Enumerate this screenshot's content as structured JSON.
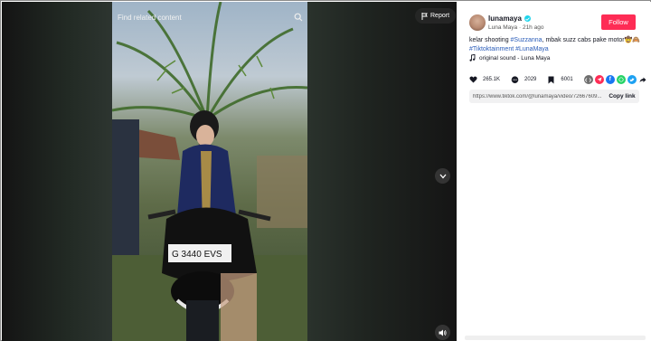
{
  "overlay": {
    "find_related": "Find related content",
    "report_label": "Report"
  },
  "author": {
    "username": "lunamaya",
    "display_name": "Luna Maya",
    "posted": "21h ago",
    "follow_label": "Follow"
  },
  "caption": {
    "text": "kelar shooting ",
    "tag1": "#Suzzanna",
    "text2": ", mbak suzz cabs pake motor🤠🙈 ",
    "tag2": "#Tiktoktainment",
    "tag3": "#LunaMaya"
  },
  "sound": "original sound - Luna Maya",
  "stats": {
    "likes": "265.1K",
    "comments": "2029",
    "saves": "6001"
  },
  "link": {
    "url": "https://www.tiktok.com/@lunamaya/video/72667609...",
    "copy_label": "Copy link"
  },
  "colors": {
    "follow": "#fe2c55",
    "hashtag": "#2b5db9",
    "verified": "#20d5ec"
  }
}
